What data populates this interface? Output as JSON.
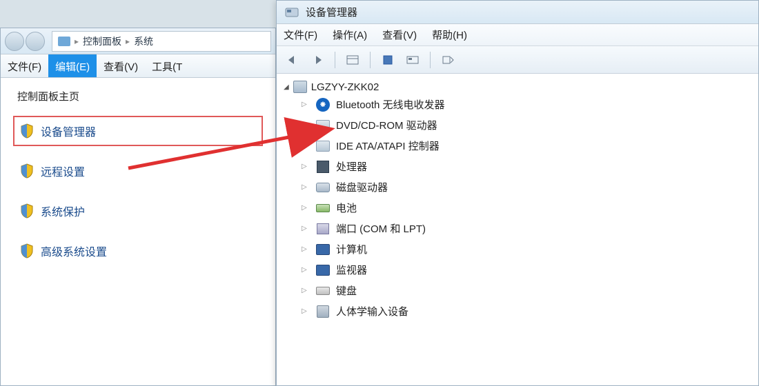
{
  "back_window": {
    "breadcrumb": {
      "item1": "控制面板",
      "item2": "系统"
    },
    "menu": {
      "file": "文件(F)",
      "edit": "编辑(E)",
      "view": "查看(V)",
      "tools": "工具(T"
    },
    "section_title": "控制面板主页",
    "sidebar": [
      {
        "label": "设备管理器",
        "selected": true
      },
      {
        "label": "远程设置",
        "selected": false
      },
      {
        "label": "系统保护",
        "selected": false
      },
      {
        "label": "高级系统设置",
        "selected": false
      }
    ]
  },
  "front_window": {
    "title": "设备管理器",
    "menu": {
      "file": "文件(F)",
      "action": "操作(A)",
      "view": "查看(V)",
      "help": "帮助(H)"
    },
    "tree": {
      "root": "LGZYY-ZKK02",
      "nodes": [
        {
          "label": "Bluetooth 无线电收发器",
          "icon": "bluetooth"
        },
        {
          "label": "DVD/CD-ROM 驱动器",
          "icon": "optical"
        },
        {
          "label": "IDE ATA/ATAPI 控制器",
          "icon": "ide"
        },
        {
          "label": "处理器",
          "icon": "chip"
        },
        {
          "label": "磁盘驱动器",
          "icon": "disk"
        },
        {
          "label": "电池",
          "icon": "battery"
        },
        {
          "label": "端口 (COM 和 LPT)",
          "icon": "port"
        },
        {
          "label": "计算机",
          "icon": "computer"
        },
        {
          "label": "监视器",
          "icon": "monitor"
        },
        {
          "label": "键盘",
          "icon": "keyboard"
        },
        {
          "label": "人体学输入设备",
          "icon": "hid"
        }
      ]
    }
  },
  "colors": {
    "arrow": "#e03030",
    "selection_border": "#e05858",
    "menu_active_bg": "#1e90e8"
  }
}
